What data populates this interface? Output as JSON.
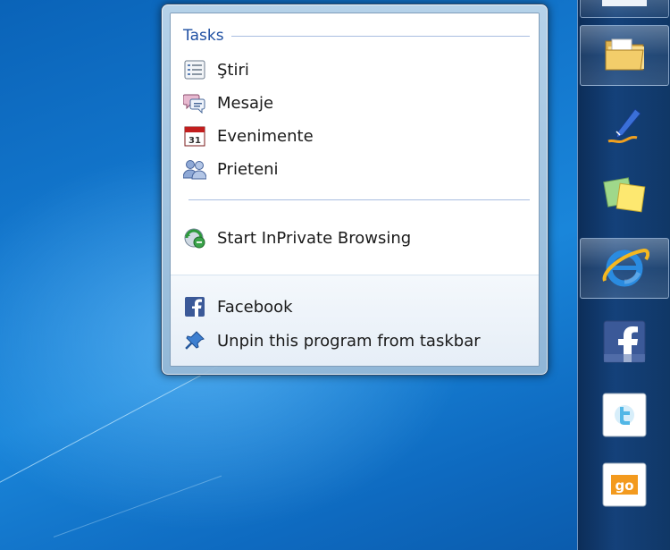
{
  "jumplist": {
    "tasks_header": "Tasks",
    "tasks": [
      {
        "label": "Ştiri",
        "icon": "news-list-icon"
      },
      {
        "label": "Mesaje",
        "icon": "messages-icon"
      },
      {
        "label": "Evenimente",
        "icon": "calendar-icon"
      },
      {
        "label": "Prieteni",
        "icon": "friends-icon"
      }
    ],
    "inprivate": {
      "label": "Start InPrivate Browsing",
      "icon": "inprivate-icon"
    },
    "pinned": [
      {
        "label": "Facebook",
        "icon": "facebook-icon"
      },
      {
        "label": "Unpin this program from taskbar",
        "icon": "unpin-icon"
      }
    ],
    "calendar_day": "31"
  },
  "taskbar": {
    "items": [
      {
        "name": "windows-explorer",
        "icon": "folder-icon",
        "active": true
      },
      {
        "name": "windows-live-writer",
        "icon": "pen-icon",
        "active": false
      },
      {
        "name": "sticky-notes",
        "icon": "sticky-notes-icon",
        "active": false
      },
      {
        "name": "internet-explorer",
        "icon": "ie-icon",
        "active": true
      },
      {
        "name": "facebook",
        "icon": "facebook-icon",
        "active": false
      },
      {
        "name": "twitter",
        "icon": "twitter-icon",
        "active": false
      },
      {
        "name": "go",
        "icon": "go-icon",
        "active": false
      }
    ],
    "go_label": "go"
  },
  "colors": {
    "accent": "#1e4fa2",
    "facebook_blue": "#3b5998",
    "desktop": "#1479cf"
  }
}
